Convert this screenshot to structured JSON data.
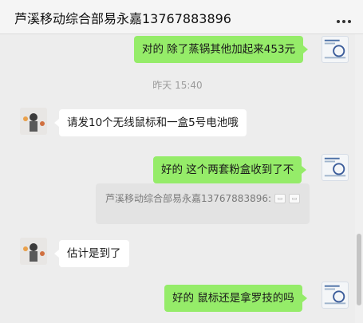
{
  "header": {
    "title": "芦溪移动综合部易永嘉13767883896"
  },
  "messages": {
    "m1": {
      "text": "对的 除了蒸锅其他加起来453元"
    },
    "ts": {
      "text": "昨天 15:40"
    },
    "m2": {
      "text": "请发10个无线鼠标和一盒5号电池哦"
    },
    "m3": {
      "text": "好的 这个两套粉盒收到了不"
    },
    "quote": {
      "sender": "芦溪移动综合部易永嘉13767883896:"
    },
    "m4": {
      "text": "估计是到了"
    },
    "m5": {
      "text": "好的 鼠标还是拿罗技的吗"
    }
  },
  "colors": {
    "sent_bubble": "#95ec69",
    "received_bubble": "#ffffff",
    "background": "#ededed"
  },
  "icons": {
    "more": "more-icon",
    "my_avatar": "avatar",
    "contact_avatar": "avatar"
  }
}
